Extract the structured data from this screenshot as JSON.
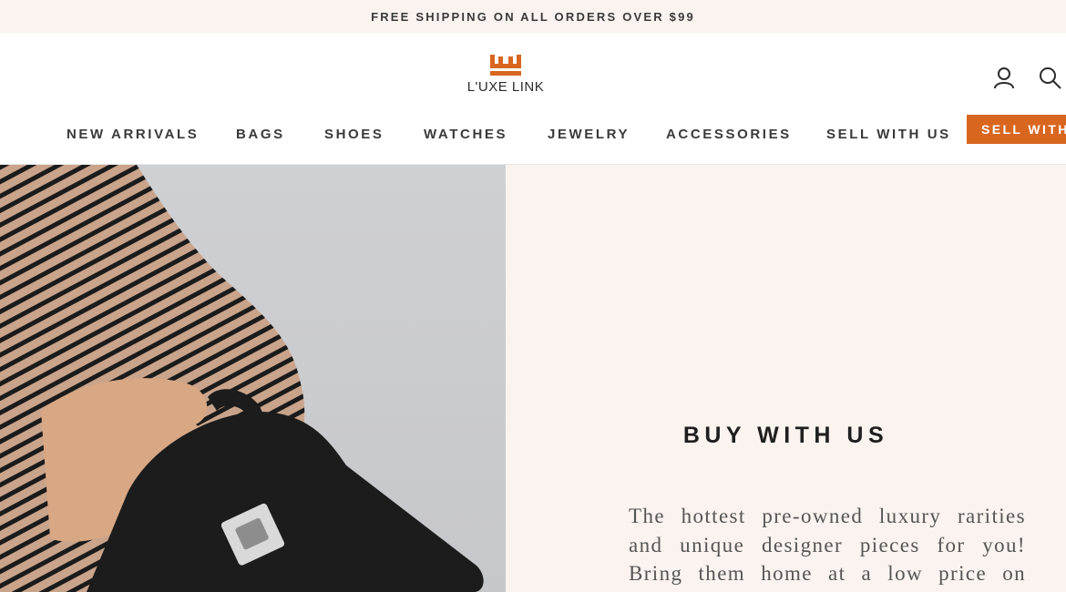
{
  "announcement": "FREE SHIPPING ON ALL ORDERS OVER $99",
  "brand": {
    "name": "L'UXE LINK",
    "accent_color": "#d9661f",
    "logo_icon": "crown-icon"
  },
  "header_icons": [
    "account-icon",
    "search-icon"
  ],
  "nav": {
    "items": [
      "NEW ARRIVALS",
      "BAGS",
      "SHOES",
      "WATCHES",
      "JEWELRY",
      "ACCESSORIES",
      "SELL WITH US"
    ],
    "cta_label": "SELL WITH"
  },
  "hero": {
    "image": "model-striped-sweater-holding-black-handbag",
    "title": "BUY WITH US",
    "text": "The hottest pre-owned luxury rarities and unique designer pieces for you! Bring them home at a low price on LUXE"
  }
}
